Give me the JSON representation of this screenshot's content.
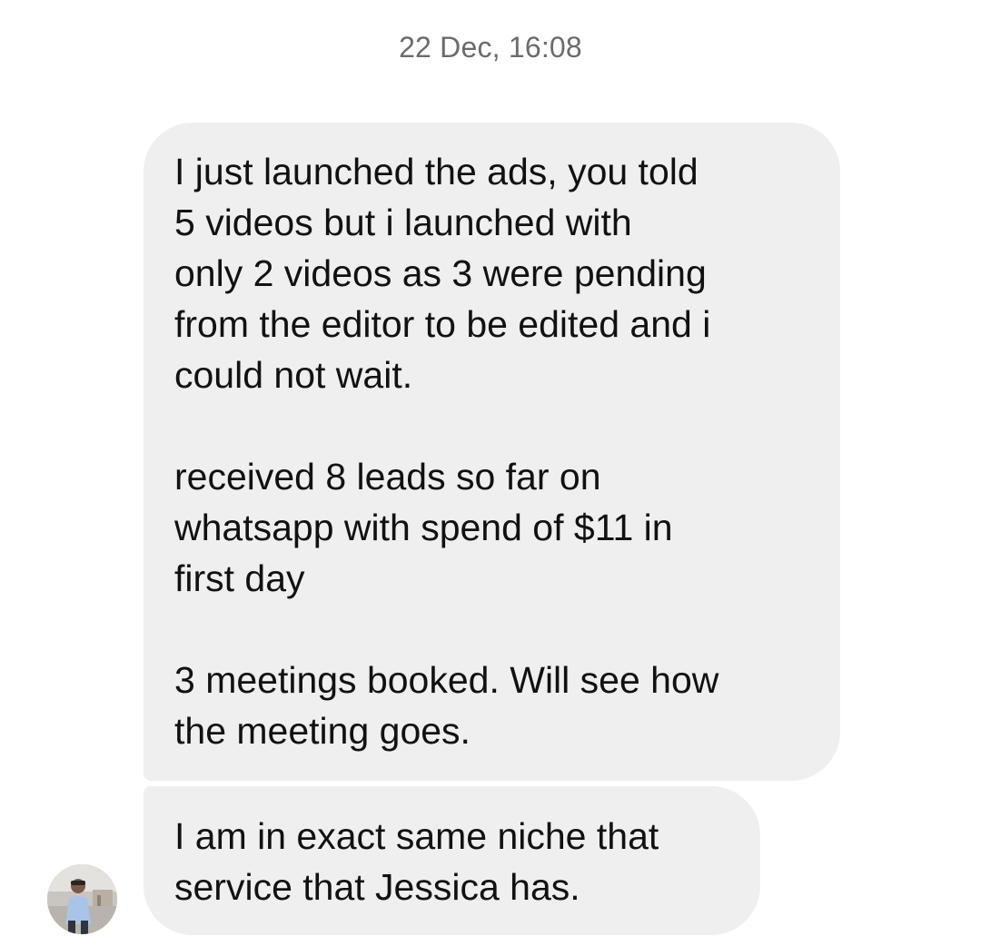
{
  "conversation": {
    "timestamp": "22 Dec, 16:08",
    "messages": [
      {
        "paragraphs": [
          "I just launched the ads, you told\n5 videos but i launched with\nonly 2 videos as 3 were pending\nfrom the editor to be edited and i\ncould not wait.",
          "received 8 leads so far on\nwhatsapp with spend of $11 in\nfirst day",
          "3 meetings booked. Will see how\nthe meeting goes."
        ]
      },
      {
        "paragraphs": [
          "I am in exact same niche that\nservice that Jessica has."
        ]
      }
    ],
    "sender": {
      "avatar_icon": "profile-photo"
    }
  },
  "colors": {
    "bubble_background": "#efefef",
    "timestamp_text": "#6b6b6b",
    "message_text": "#111111"
  }
}
